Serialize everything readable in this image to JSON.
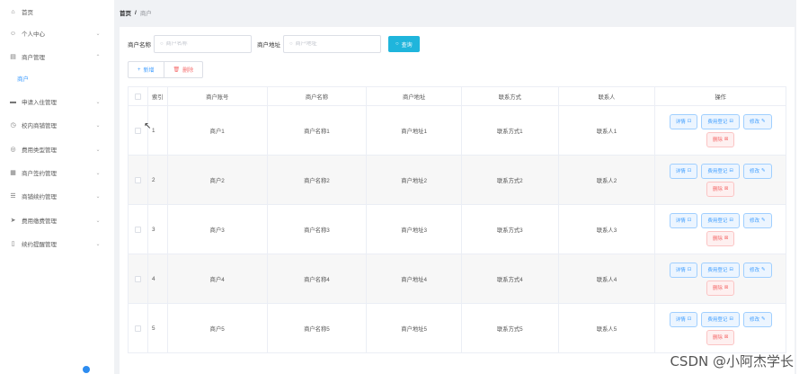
{
  "sidebar": {
    "items": [
      {
        "label": "首页",
        "icon": "home-icon",
        "glyph": "⌂",
        "has_arrow": false
      },
      {
        "label": "个人中心",
        "icon": "user-icon",
        "glyph": "☺",
        "has_arrow": true,
        "arrow": "⌄"
      },
      {
        "label": "商户管理",
        "icon": "shop-icon",
        "glyph": "▤",
        "has_arrow": true,
        "arrow": "⌃"
      },
      {
        "label": "申请入住管理",
        "icon": "monitor-icon",
        "glyph": "▬",
        "has_arrow": true,
        "arrow": "⌄"
      },
      {
        "label": "校内商铺管理",
        "icon": "clock-icon",
        "glyph": "◷",
        "has_arrow": true,
        "arrow": "⌄"
      },
      {
        "label": "费用类型管理",
        "icon": "coin-icon",
        "glyph": "◎",
        "has_arrow": true,
        "arrow": "⌄"
      },
      {
        "label": "商户签约管理",
        "icon": "grid-icon",
        "glyph": "▦",
        "has_arrow": true,
        "arrow": "⌄"
      },
      {
        "label": "商铺续约管理",
        "icon": "list-icon",
        "glyph": "☰",
        "has_arrow": true,
        "arrow": "⌄"
      },
      {
        "label": "费用缴费管理",
        "icon": "send-icon",
        "glyph": "➤",
        "has_arrow": true,
        "arrow": "⌄"
      },
      {
        "label": "续约提醒管理",
        "icon": "bell-icon",
        "glyph": "▯",
        "has_arrow": true,
        "arrow": "⌄"
      }
    ],
    "submenu_active": "商户"
  },
  "breadcrumb": {
    "home": "首页",
    "sep": "/",
    "current": "商户"
  },
  "search": {
    "name_label": "商户名称",
    "name_placeholder": "商户名称",
    "addr_label": "商户地址",
    "addr_placeholder": "商户地址",
    "button": "查询",
    "icon_glyph": "○"
  },
  "actions": {
    "add": "新增",
    "add_glyph": "+",
    "delete": "删除",
    "delete_glyph": "🗑"
  },
  "table": {
    "headers": [
      "",
      "索引",
      "商户账号",
      "商户名称",
      "商户地址",
      "联系方式",
      "联系人",
      "操作"
    ],
    "rows": [
      {
        "idx": "1",
        "account": "商户1",
        "name": "商户名称1",
        "addr": "商户地址1",
        "contact": "联系方式1",
        "person": "联系人1"
      },
      {
        "idx": "2",
        "account": "商户2",
        "name": "商户名称2",
        "addr": "商户地址2",
        "contact": "联系方式2",
        "person": "联系人2"
      },
      {
        "idx": "3",
        "account": "商户3",
        "name": "商户名称3",
        "addr": "商户地址3",
        "contact": "联系方式3",
        "person": "联系人3"
      },
      {
        "idx": "4",
        "account": "商户4",
        "name": "商户名称4",
        "addr": "商户地址4",
        "contact": "联系方式4",
        "person": "联系人4"
      },
      {
        "idx": "5",
        "account": "商户5",
        "name": "商户名称5",
        "addr": "商户地址5",
        "contact": "联系方式5",
        "person": "联系人5"
      }
    ],
    "ops": {
      "detail": "详情",
      "detail_glyph": "⊡",
      "payment": "费用登记",
      "payment_glyph": "⊟",
      "edit": "修改",
      "edit_glyph": "✎",
      "delete": "删除",
      "delete_glyph": "⊠"
    }
  },
  "watermark": "CSDN @小阿杰学长",
  "colors": {
    "primary": "#409eff",
    "search_button": "#1fb5dc",
    "danger": "#f56c6c",
    "sidebar_active": "#409eff"
  }
}
